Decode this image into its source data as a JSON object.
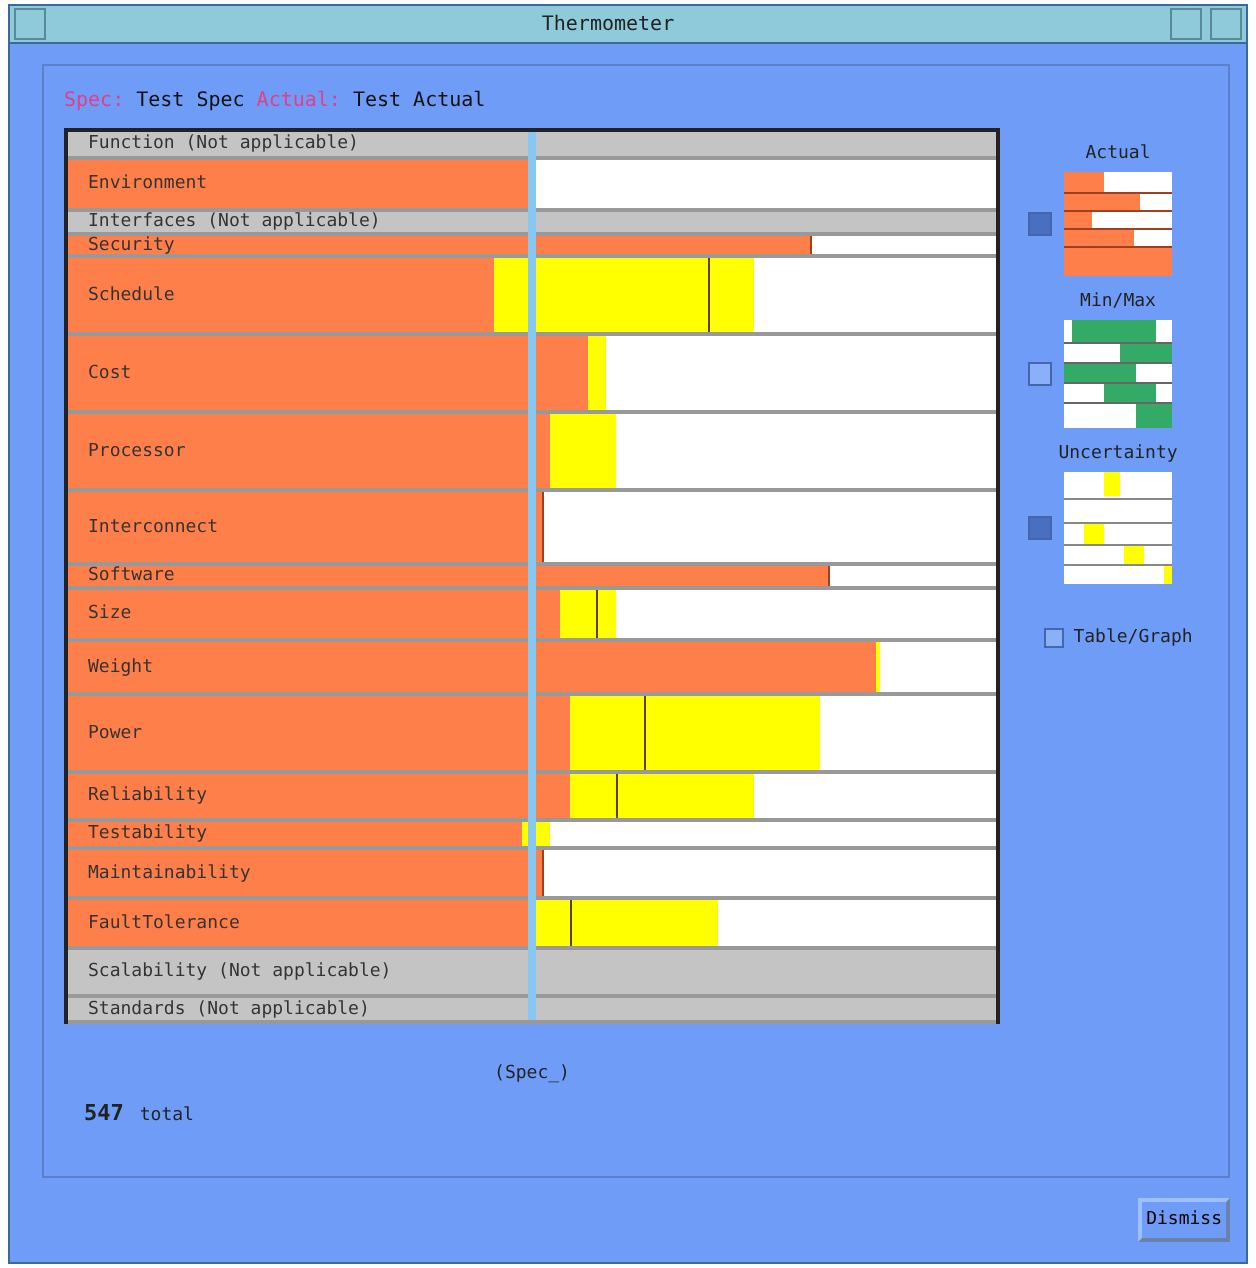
{
  "window": {
    "title": "Thermometer"
  },
  "legend": [
    {
      "text": "Spec:",
      "kind": "key"
    },
    {
      "text": "Test Spec",
      "kind": "value"
    },
    {
      "text": "Actual:",
      "kind": "key"
    },
    {
      "text": "Test Actual",
      "kind": "value"
    }
  ],
  "rows": [
    {
      "label": "Function (Not applicable)",
      "kind": "na"
    },
    {
      "label": "Environment",
      "kind": "bar",
      "level": 0.5
    },
    {
      "label": "Interfaces (Not applicable)",
      "kind": "na"
    },
    {
      "label": "Security",
      "kind": "bar",
      "level": 0.8
    },
    {
      "label": "Schedule",
      "kind": "bar",
      "level": 0.46
    },
    {
      "label": "Cost",
      "kind": "bar",
      "level": 0.56
    },
    {
      "label": "Processor",
      "kind": "bar",
      "level": 0.52
    },
    {
      "label": "Interconnect",
      "kind": "bar",
      "level": 0.51
    },
    {
      "label": "Software",
      "kind": "bar",
      "level": 0.82
    },
    {
      "label": "Size",
      "kind": "bar",
      "level": 0.53
    },
    {
      "label": "Weight",
      "kind": "bar",
      "level": 0.87
    },
    {
      "label": "Power",
      "kind": "bar",
      "level": 0.54
    },
    {
      "label": "Reliability",
      "kind": "bar",
      "level": 0.54
    },
    {
      "label": "Testability",
      "kind": "bar",
      "level": 0.49
    },
    {
      "label": "Maintainability",
      "kind": "bar",
      "level": 0.51
    },
    {
      "label": "FaultTolerance",
      "kind": "bar",
      "level": 0.5
    },
    {
      "label": "Scalability (Not applicable)",
      "kind": "na"
    },
    {
      "label": "Standards (Not applicable)",
      "kind": "na"
    }
  ],
  "axis_label": "(Spec_)",
  "total": {
    "value": "547",
    "label": "total"
  },
  "views": [
    {
      "label": "Actual",
      "checked": true,
      "kind": "actual"
    },
    {
      "label": "Min/Max",
      "checked": false,
      "kind": "minmax"
    },
    {
      "label": "Uncertainty",
      "checked": true,
      "kind": "uncertainty"
    }
  ],
  "table_graph": {
    "label": "Table/Graph",
    "checked": false
  },
  "buttons": [
    "Dismiss"
  ]
}
